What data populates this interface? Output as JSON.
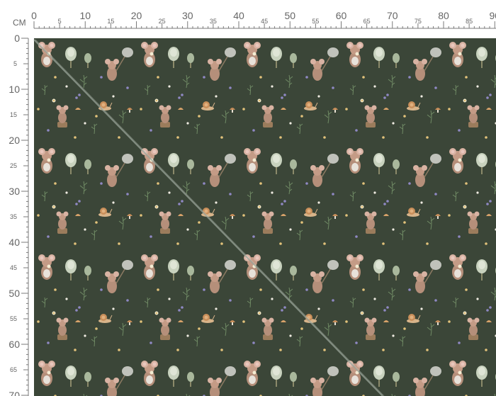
{
  "ruler": {
    "unit": "CM",
    "top_major": [
      "0",
      "10",
      "20",
      "30",
      "40",
      "50",
      "60",
      "70",
      "80",
      "90"
    ],
    "top_minor": [
      "5",
      "15",
      "25",
      "35",
      "45",
      "55",
      "65",
      "75",
      "85"
    ],
    "left_major": [
      "0",
      "10",
      "20",
      "30",
      "40",
      "50",
      "60",
      "70"
    ],
    "left_minor": [
      "5",
      "15",
      "25",
      "35",
      "45",
      "55",
      "65"
    ]
  },
  "colors": {
    "fabric": "#3b4638",
    "ruler_line": "#7a7a7a",
    "ruler_text": "#666666",
    "fold_line": "#9aa59a"
  },
  "pattern": {
    "motifs": [
      "mouse-holding-flower-icon",
      "mouse-with-butterfly-net-icon",
      "mouse-on-stump-icon",
      "round-tree-icon",
      "snail-icon",
      "wildflower-sprig-icon",
      "mushroom-icon"
    ]
  }
}
